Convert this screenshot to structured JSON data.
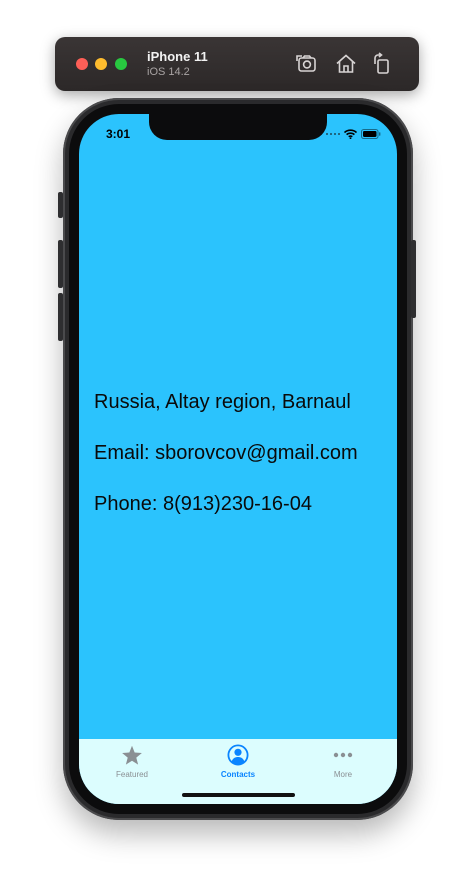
{
  "simulator": {
    "device_name": "iPhone 11",
    "os_version": "iOS 14.2",
    "toolbar_icons": [
      "screenshot-icon",
      "home-icon",
      "rotate-icon"
    ]
  },
  "status_bar": {
    "time": "3:01",
    "icons": [
      "cellular-icon",
      "wifi-icon",
      "battery-icon"
    ]
  },
  "content": {
    "address": "Russia, Altay region, Barnaul",
    "email": "Email: sborovcov@gmail.com",
    "phone": "Phone: 8(913)230-16-04"
  },
  "tab_bar": {
    "selected": "Contacts",
    "tabs": [
      {
        "label": "Featured",
        "icon": "star-icon"
      },
      {
        "label": "Contacts",
        "icon": "contacts-icon"
      },
      {
        "label": "More",
        "icon": "more-icon"
      }
    ]
  },
  "colors": {
    "screen_background": "#2bc3fd",
    "tab_bar_background": "#dcfdfe",
    "tab_selected": "#0a84ff",
    "tab_unselected": "#8a8f93"
  }
}
